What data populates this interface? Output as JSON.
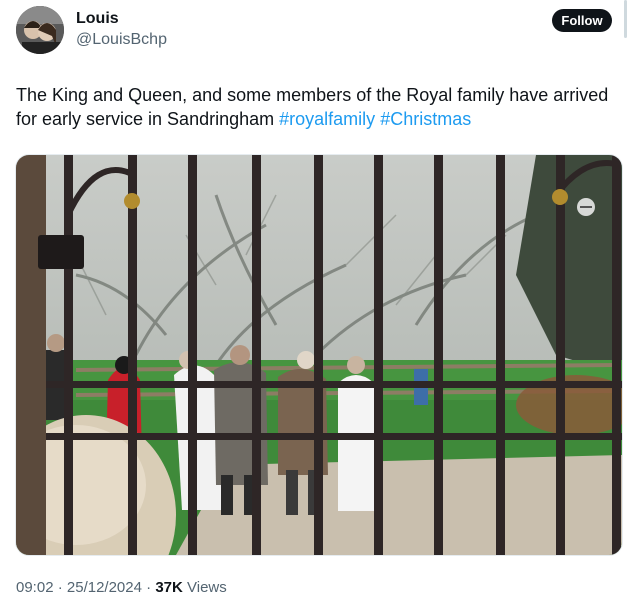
{
  "user": {
    "display_name": "Louis",
    "handle": "@LouisBchp",
    "follow_label": "Follow"
  },
  "tweet": {
    "text": "The King and Queen, and some members of the Royal family have arrived for early service in Sandringham",
    "hashtags": [
      "#royalfamily",
      "#Christmas"
    ]
  },
  "meta": {
    "time": "09:02",
    "sep1": "·",
    "date": "25/12/2024",
    "sep2": "·",
    "views_count": "37K",
    "views_label": "Views"
  },
  "colors": {
    "text": "#0f1419",
    "secondary": "#536471",
    "link": "#1d9bf0",
    "button_bg": "#0f1419"
  },
  "icons": [
    "avatar-photo",
    "more-options-icon"
  ]
}
